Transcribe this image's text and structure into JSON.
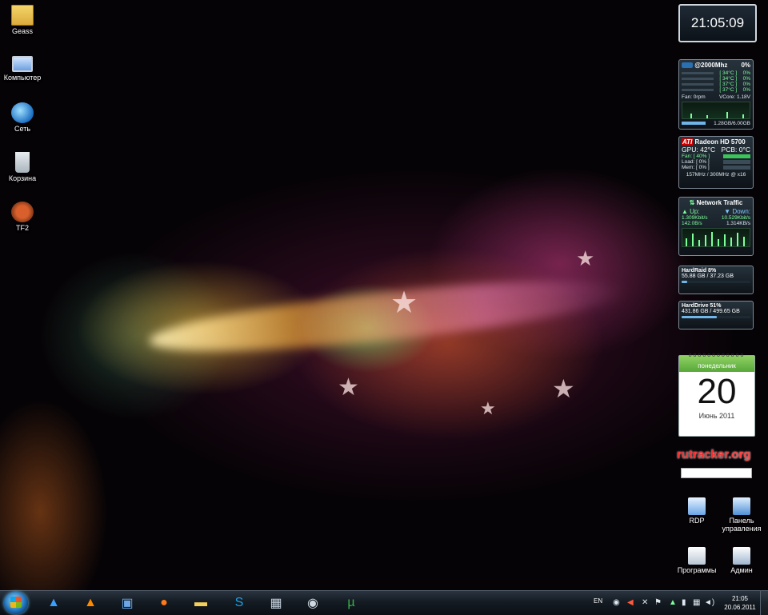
{
  "desktop_icons": [
    {
      "label": "Geass",
      "icon": "folder-icon"
    },
    {
      "label": "Компьютер",
      "icon": "computer-icon"
    },
    {
      "label": "Сеть",
      "icon": "network-icon"
    },
    {
      "label": "Корзина",
      "icon": "recycle-bin-icon"
    },
    {
      "label": "TF2",
      "icon": "tf2-icon"
    }
  ],
  "clock_gadget": {
    "time": "21:05:09"
  },
  "cpu_gadget": {
    "title": "@2000Mhz",
    "usage": "0%",
    "cores": [
      {
        "temp": "[ 34°C ]",
        "usage": "0%"
      },
      {
        "temp": "[ 34°C ]",
        "usage": "0%"
      },
      {
        "temp": "[ 37°C ]",
        "usage": "0%"
      },
      {
        "temp": "[ 37°C ]",
        "usage": "0%"
      }
    ],
    "fan": "Fan: 0rpm",
    "vcore": "VCore: 1.18V",
    "memory": "1.28GB/6.00GB"
  },
  "gpu_gadget": {
    "brand": "ATI",
    "title": "Radeon HD 5700",
    "gpu_temp": "GPU: 42°C",
    "pcb_temp": "PCB: 0°C",
    "fan": "Fan: [ 40% ]",
    "load": "Load: [ 0% ]",
    "mem": "Mem: [ 0% ]",
    "clocks": "157MHz / 300MHz @ x16"
  },
  "network_gadget": {
    "title": "Network Traffic",
    "up_label": "Up:",
    "down_label": "Down:",
    "up_total": "1.309Kbit/s",
    "down_total": "10.529Kbit/s",
    "up_rate": "142.0B/s",
    "down_rate": "1.314KB/s"
  },
  "hdd_gadgets": [
    {
      "title": "HardRaid  8%",
      "usage_text": "55.88 GB / 37.23 GB",
      "fraction": 0.08
    },
    {
      "title": "HardDrive  51%",
      "usage_text": "431.86 GB / 499.65 GB",
      "fraction": 0.51
    }
  ],
  "calendar": {
    "weekday": "понедельник",
    "day": "20",
    "month": "Июнь 2011"
  },
  "rutracker": {
    "part1": "rutracker",
    "part2": ".org"
  },
  "right_icons": [
    {
      "label": "RDP",
      "icon": "rdp-icon"
    },
    {
      "label": "Панель управления",
      "icon": "control-panel-icon"
    },
    {
      "label": "Программы",
      "icon": "programs-icon"
    },
    {
      "label": "Админ",
      "icon": "admin-icon"
    }
  ],
  "taskbar": {
    "pinned": [
      {
        "name": "aimp-icon",
        "glyph": "▲",
        "color": "#3aa0ff"
      },
      {
        "name": "vlc-icon",
        "glyph": "▲",
        "color": "#ff8a00"
      },
      {
        "name": "cpuz-icon",
        "glyph": "▣",
        "color": "#6aa6e8"
      },
      {
        "name": "firefox-icon",
        "glyph": "●",
        "color": "#ff7a1a"
      },
      {
        "name": "explorer-icon",
        "glyph": "▬",
        "color": "#f3cf5b"
      },
      {
        "name": "skype-icon",
        "glyph": "S",
        "color": "#1ea1e9"
      },
      {
        "name": "calculator-icon",
        "glyph": "▦",
        "color": "#c7d4e2"
      },
      {
        "name": "steam-icon",
        "glyph": "◉",
        "color": "#cfd8e0"
      },
      {
        "name": "utorrent-icon",
        "glyph": "µ",
        "color": "#3bb34a"
      }
    ],
    "language": "EN",
    "time": "21:05",
    "date": "20.06.2011"
  }
}
